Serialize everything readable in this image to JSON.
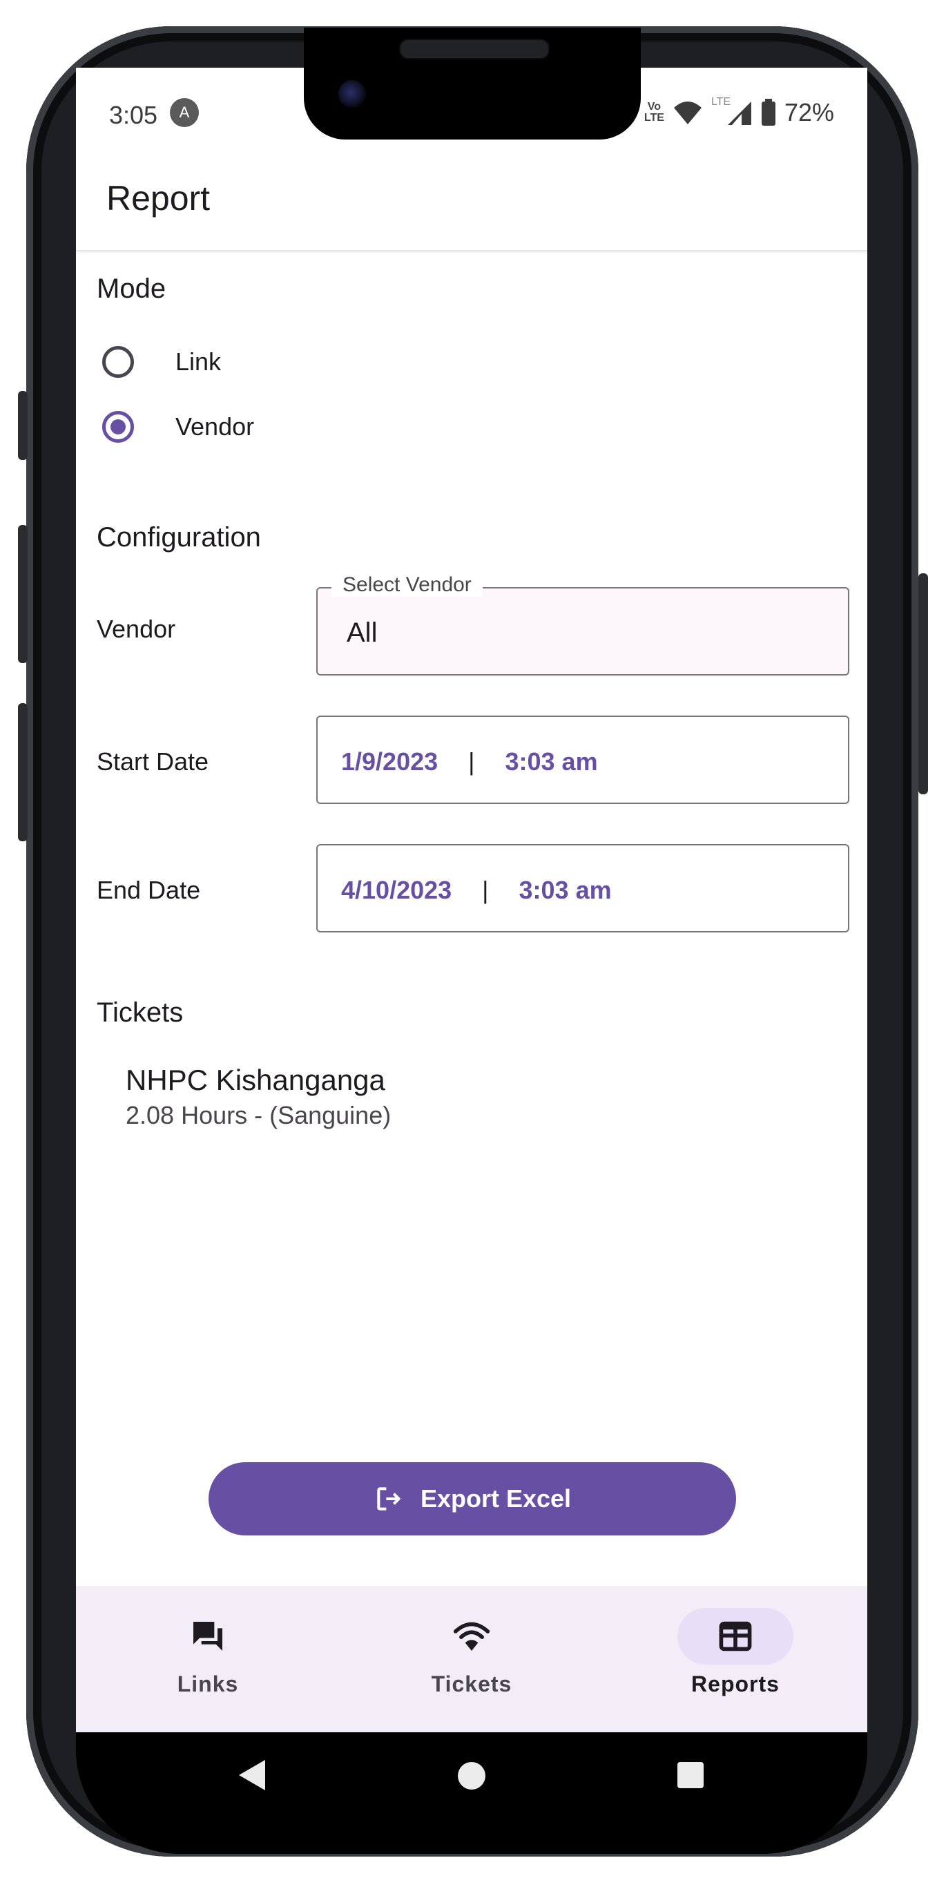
{
  "status_bar": {
    "time": "3:05",
    "app_icon": "A",
    "volte_top": "Vo",
    "volte_bottom": "LTE",
    "lte_label": "LTE",
    "battery": "72%"
  },
  "app_bar": {
    "title": "Report"
  },
  "mode": {
    "title": "Mode",
    "options": [
      {
        "label": "Link",
        "selected": false
      },
      {
        "label": "Vendor",
        "selected": true
      }
    ]
  },
  "configuration": {
    "title": "Configuration",
    "vendor_label": "Vendor",
    "vendor_select_label": "Select Vendor",
    "vendor_value": "All",
    "start_label": "Start Date",
    "start_date": "1/9/2023",
    "start_time": "3:03 am",
    "end_label": "End Date",
    "end_date": "4/10/2023",
    "end_time": "3:03 am",
    "separator": "|"
  },
  "tickets": {
    "title": "Tickets",
    "items": [
      {
        "name": "NHPC Kishanganga",
        "detail": "2.08 Hours - (Sanguine)"
      }
    ]
  },
  "export_button": {
    "label": "Export Excel",
    "icon": "logout-icon"
  },
  "bottom_nav": {
    "items": [
      {
        "label": "Links",
        "icon": "forum-icon",
        "active": false
      },
      {
        "label": "Tickets",
        "icon": "wifi-icon",
        "active": false
      },
      {
        "label": "Reports",
        "icon": "table-icon",
        "active": true
      }
    ]
  },
  "colors": {
    "primary": "#6750a4",
    "nav_background": "#f3edf7",
    "nav_active_pill": "#e8def8",
    "select_fill": "#fdf7fb"
  }
}
